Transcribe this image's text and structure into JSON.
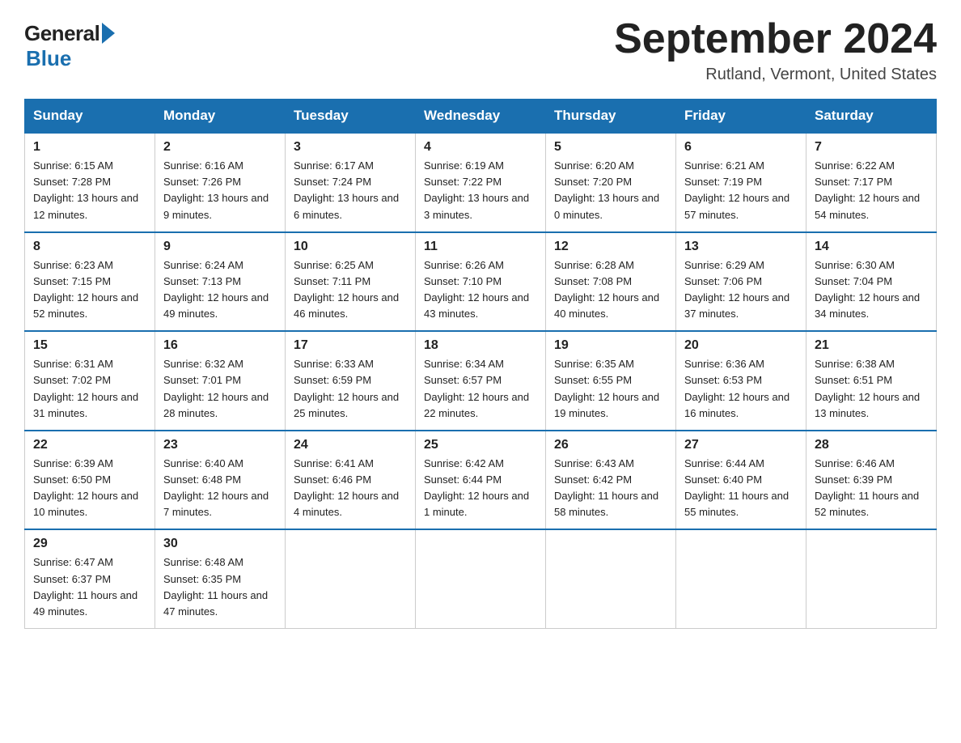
{
  "logo": {
    "general": "General",
    "blue": "Blue"
  },
  "title": "September 2024",
  "location": "Rutland, Vermont, United States",
  "days_of_week": [
    "Sunday",
    "Monday",
    "Tuesday",
    "Wednesday",
    "Thursday",
    "Friday",
    "Saturday"
  ],
  "weeks": [
    [
      {
        "day": "1",
        "sunrise": "6:15 AM",
        "sunset": "7:28 PM",
        "daylight": "13 hours and 12 minutes."
      },
      {
        "day": "2",
        "sunrise": "6:16 AM",
        "sunset": "7:26 PM",
        "daylight": "13 hours and 9 minutes."
      },
      {
        "day": "3",
        "sunrise": "6:17 AM",
        "sunset": "7:24 PM",
        "daylight": "13 hours and 6 minutes."
      },
      {
        "day": "4",
        "sunrise": "6:19 AM",
        "sunset": "7:22 PM",
        "daylight": "13 hours and 3 minutes."
      },
      {
        "day": "5",
        "sunrise": "6:20 AM",
        "sunset": "7:20 PM",
        "daylight": "13 hours and 0 minutes."
      },
      {
        "day": "6",
        "sunrise": "6:21 AM",
        "sunset": "7:19 PM",
        "daylight": "12 hours and 57 minutes."
      },
      {
        "day": "7",
        "sunrise": "6:22 AM",
        "sunset": "7:17 PM",
        "daylight": "12 hours and 54 minutes."
      }
    ],
    [
      {
        "day": "8",
        "sunrise": "6:23 AM",
        "sunset": "7:15 PM",
        "daylight": "12 hours and 52 minutes."
      },
      {
        "day": "9",
        "sunrise": "6:24 AM",
        "sunset": "7:13 PM",
        "daylight": "12 hours and 49 minutes."
      },
      {
        "day": "10",
        "sunrise": "6:25 AM",
        "sunset": "7:11 PM",
        "daylight": "12 hours and 46 minutes."
      },
      {
        "day": "11",
        "sunrise": "6:26 AM",
        "sunset": "7:10 PM",
        "daylight": "12 hours and 43 minutes."
      },
      {
        "day": "12",
        "sunrise": "6:28 AM",
        "sunset": "7:08 PM",
        "daylight": "12 hours and 40 minutes."
      },
      {
        "day": "13",
        "sunrise": "6:29 AM",
        "sunset": "7:06 PM",
        "daylight": "12 hours and 37 minutes."
      },
      {
        "day": "14",
        "sunrise": "6:30 AM",
        "sunset": "7:04 PM",
        "daylight": "12 hours and 34 minutes."
      }
    ],
    [
      {
        "day": "15",
        "sunrise": "6:31 AM",
        "sunset": "7:02 PM",
        "daylight": "12 hours and 31 minutes."
      },
      {
        "day": "16",
        "sunrise": "6:32 AM",
        "sunset": "7:01 PM",
        "daylight": "12 hours and 28 minutes."
      },
      {
        "day": "17",
        "sunrise": "6:33 AM",
        "sunset": "6:59 PM",
        "daylight": "12 hours and 25 minutes."
      },
      {
        "day": "18",
        "sunrise": "6:34 AM",
        "sunset": "6:57 PM",
        "daylight": "12 hours and 22 minutes."
      },
      {
        "day": "19",
        "sunrise": "6:35 AM",
        "sunset": "6:55 PM",
        "daylight": "12 hours and 19 minutes."
      },
      {
        "day": "20",
        "sunrise": "6:36 AM",
        "sunset": "6:53 PM",
        "daylight": "12 hours and 16 minutes."
      },
      {
        "day": "21",
        "sunrise": "6:38 AM",
        "sunset": "6:51 PM",
        "daylight": "12 hours and 13 minutes."
      }
    ],
    [
      {
        "day": "22",
        "sunrise": "6:39 AM",
        "sunset": "6:50 PM",
        "daylight": "12 hours and 10 minutes."
      },
      {
        "day": "23",
        "sunrise": "6:40 AM",
        "sunset": "6:48 PM",
        "daylight": "12 hours and 7 minutes."
      },
      {
        "day": "24",
        "sunrise": "6:41 AM",
        "sunset": "6:46 PM",
        "daylight": "12 hours and 4 minutes."
      },
      {
        "day": "25",
        "sunrise": "6:42 AM",
        "sunset": "6:44 PM",
        "daylight": "12 hours and 1 minute."
      },
      {
        "day": "26",
        "sunrise": "6:43 AM",
        "sunset": "6:42 PM",
        "daylight": "11 hours and 58 minutes."
      },
      {
        "day": "27",
        "sunrise": "6:44 AM",
        "sunset": "6:40 PM",
        "daylight": "11 hours and 55 minutes."
      },
      {
        "day": "28",
        "sunrise": "6:46 AM",
        "sunset": "6:39 PM",
        "daylight": "11 hours and 52 minutes."
      }
    ],
    [
      {
        "day": "29",
        "sunrise": "6:47 AM",
        "sunset": "6:37 PM",
        "daylight": "11 hours and 49 minutes."
      },
      {
        "day": "30",
        "sunrise": "6:48 AM",
        "sunset": "6:35 PM",
        "daylight": "11 hours and 47 minutes."
      },
      null,
      null,
      null,
      null,
      null
    ]
  ]
}
